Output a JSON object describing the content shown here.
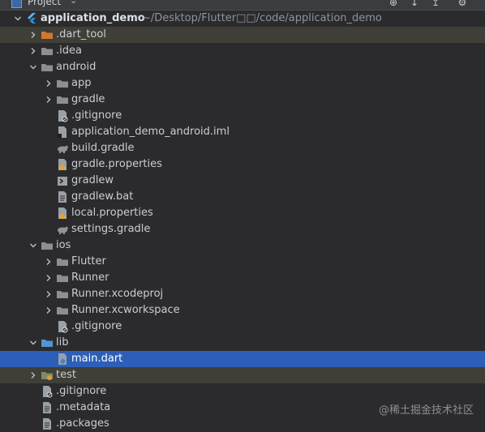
{
  "header": {
    "title": "Project",
    "icons": [
      "project-icon",
      "chevron-down-icon",
      "locate-icon",
      "expand-all-icon",
      "collapse-all-icon",
      "gear-icon"
    ]
  },
  "tree": [
    {
      "label": "application_demo",
      "path": "~/Desktop/Flutter□□/code/application_demo",
      "icon": "flutter-module-icon",
      "expanded": true,
      "bold": true
    },
    {
      "label": ".dart_tool",
      "icon": "folder-icon",
      "highlight": true
    },
    {
      "label": ".idea",
      "icon": "folder-icon"
    },
    {
      "label": "android",
      "icon": "folder-icon",
      "expanded": true
    },
    {
      "label": "app",
      "icon": "folder-icon"
    },
    {
      "label": "gradle",
      "icon": "folder-icon"
    },
    {
      "label": ".gitignore",
      "icon": "ignore-file-icon"
    },
    {
      "label": "application_demo_android.iml",
      "icon": "iml-file-icon"
    },
    {
      "label": "build.gradle",
      "icon": "gradle-icon"
    },
    {
      "label": "gradle.properties",
      "icon": "properties-file-icon"
    },
    {
      "label": "gradlew",
      "icon": "shell-script-icon"
    },
    {
      "label": "gradlew.bat",
      "icon": "text-file-icon"
    },
    {
      "label": "local.properties",
      "icon": "properties-file-icon"
    },
    {
      "label": "settings.gradle",
      "icon": "gradle-icon"
    },
    {
      "label": "ios",
      "icon": "folder-icon",
      "expanded": true
    },
    {
      "label": "Flutter",
      "icon": "folder-icon"
    },
    {
      "label": "Runner",
      "icon": "folder-icon"
    },
    {
      "label": "Runner.xcodeproj",
      "icon": "folder-icon"
    },
    {
      "label": "Runner.xcworkspace",
      "icon": "folder-icon"
    },
    {
      "label": ".gitignore",
      "icon": "ignore-file-icon"
    },
    {
      "label": "lib",
      "icon": "source-folder-icon",
      "expanded": true
    },
    {
      "label": "main.dart",
      "icon": "dart-file-icon",
      "selected": true
    },
    {
      "label": "test",
      "icon": "test-folder-icon",
      "highlight": true
    },
    {
      "label": ".gitignore",
      "icon": "ignore-file-icon"
    },
    {
      "label": ".metadata",
      "icon": "text-file-icon"
    },
    {
      "label": ".packages",
      "icon": "text-file-icon"
    }
  ],
  "watermark": "@稀土掘金技术社区",
  "colors": {
    "background": "#2b2b2d",
    "selection": "#2d5fb9",
    "excluded_row": "#3f3f37",
    "folder": "#8a8f96",
    "excluded_folder": "#d0782f",
    "source_folder": "#5594d6"
  }
}
